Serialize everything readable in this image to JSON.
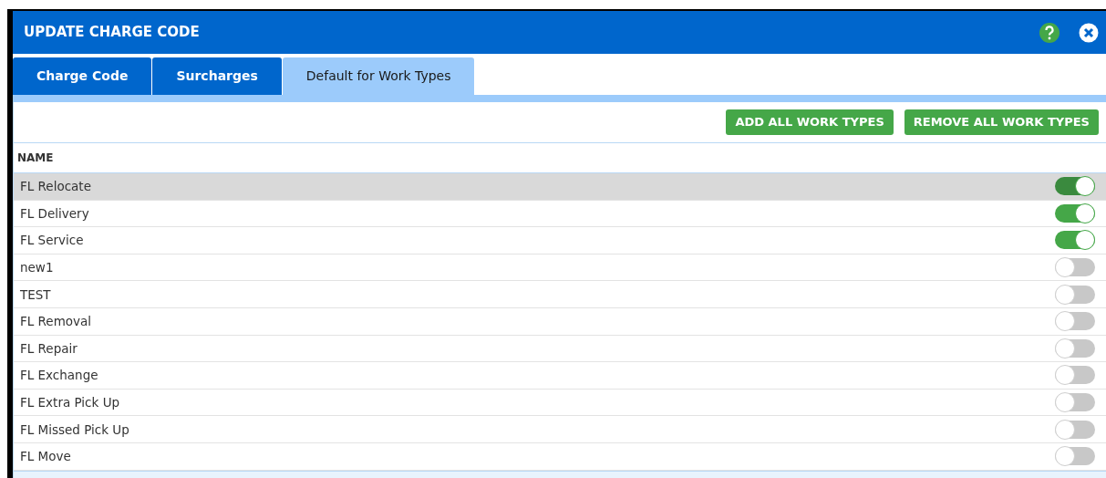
{
  "dialog": {
    "title": "UPDATE CHARGE CODE"
  },
  "tabs": [
    {
      "label": "Charge Code",
      "selected": false
    },
    {
      "label": "Surcharges",
      "selected": false
    },
    {
      "label": "Default for Work Types",
      "selected": true
    }
  ],
  "toolbar": {
    "buttons": [
      "ADD ALL WORK TYPES",
      "REMOVE ALL WORK TYPES"
    ]
  },
  "table": {
    "columns": [
      "NAME"
    ],
    "rows": [
      {
        "name": "FL Relocate",
        "on": true,
        "highlighted": true
      },
      {
        "name": "FL Delivery",
        "on": true,
        "highlighted": false
      },
      {
        "name": "FL Service",
        "on": true,
        "highlighted": false
      },
      {
        "name": "new1",
        "on": false,
        "highlighted": false
      },
      {
        "name": "TEST",
        "on": false,
        "highlighted": false
      },
      {
        "name": "FL Removal",
        "on": false,
        "highlighted": false
      },
      {
        "name": "FL Repair",
        "on": false,
        "highlighted": false
      },
      {
        "name": "FL Exchange",
        "on": false,
        "highlighted": false
      },
      {
        "name": "FL Extra Pick Up",
        "on": false,
        "highlighted": false
      },
      {
        "name": "FL Missed Pick Up",
        "on": false,
        "highlighted": false
      },
      {
        "name": "FL Move",
        "on": false,
        "highlighted": false
      }
    ]
  }
}
